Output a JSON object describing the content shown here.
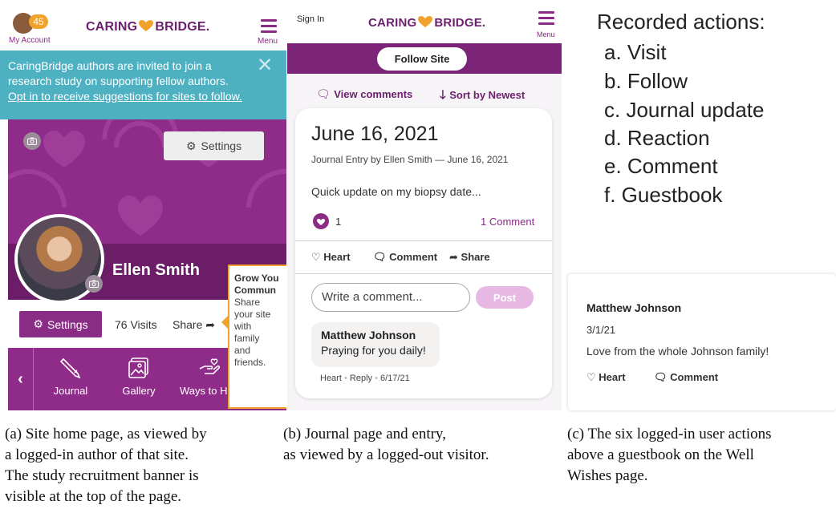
{
  "panel_a": {
    "badge_count": "45",
    "my_account": "My Account",
    "logo_left": "CARING",
    "logo_right": "BRIDGE.",
    "menu": "Menu",
    "banner_line1": "CaringBridge authors are invited to join a",
    "banner_line2": "research study on supporting fellow authors.",
    "banner_link": "Opt in to receive suggestions for sites to follow.",
    "hero_settings": "Settings",
    "owner_name": "Ellen Smith",
    "settings_button": "Settings",
    "visits": "76 Visits",
    "share": "Share",
    "nav_journal": "Journal",
    "nav_gallery": "Gallery",
    "nav_ways": "Ways to He",
    "tooltip_head1": "Grow You",
    "tooltip_head2": "Commun",
    "tooltip_lines": [
      "Share",
      "your site",
      "with",
      "family",
      "and",
      "friends."
    ]
  },
  "panel_b": {
    "sign_in": "Sign In",
    "logo_left": "CARING",
    "logo_right": "BRIDGE.",
    "menu": "Menu",
    "follow_site": "Follow Site",
    "view_comments": "View comments",
    "sort_by": "Sort by Newest",
    "entry_title": "June 16, 2021",
    "entry_byline": "Journal Entry by Ellen Smith — June 16, 2021",
    "entry_text": "Quick update on my biopsy date...",
    "reaction_count": "1",
    "comment_count": "1 Comment",
    "heart": "Heart",
    "comment": "Comment",
    "share": "Share",
    "comment_placeholder": "Write a comment...",
    "post": "Post",
    "commenter": "Matthew Johnson",
    "comment_text": "Praying for you daily!",
    "meta_heart": "Heart",
    "meta_reply": "Reply",
    "meta_date": "6/17/21"
  },
  "panel_c": {
    "title": "Recorded actions:",
    "actions": [
      "a. Visit",
      "b. Follow",
      "c. Journal update",
      "d. Reaction",
      "e. Comment",
      "f. Guestbook"
    ],
    "guest_name": "Matthew Johnson",
    "guest_date": "3/1/21",
    "guest_text": "Love from the whole Johnson family!",
    "heart": "Heart",
    "comment": "Comment"
  },
  "captions": {
    "a": [
      "(a) Site home page, as viewed by",
      "a logged-in author of that site.",
      "The study recruitment banner is",
      "visible at the top of the page."
    ],
    "b": [
      "(b) Journal page and entry,",
      "as viewed by a logged-out visitor."
    ],
    "c": [
      "(c) The six logged-in user actions",
      "above a guestbook on the Well",
      "Wishes page."
    ]
  },
  "colors": {
    "purple": "#8f2b88",
    "dark_purple": "#6b1e67",
    "teal": "#4eb1c2",
    "orange": "#f1a22c"
  }
}
